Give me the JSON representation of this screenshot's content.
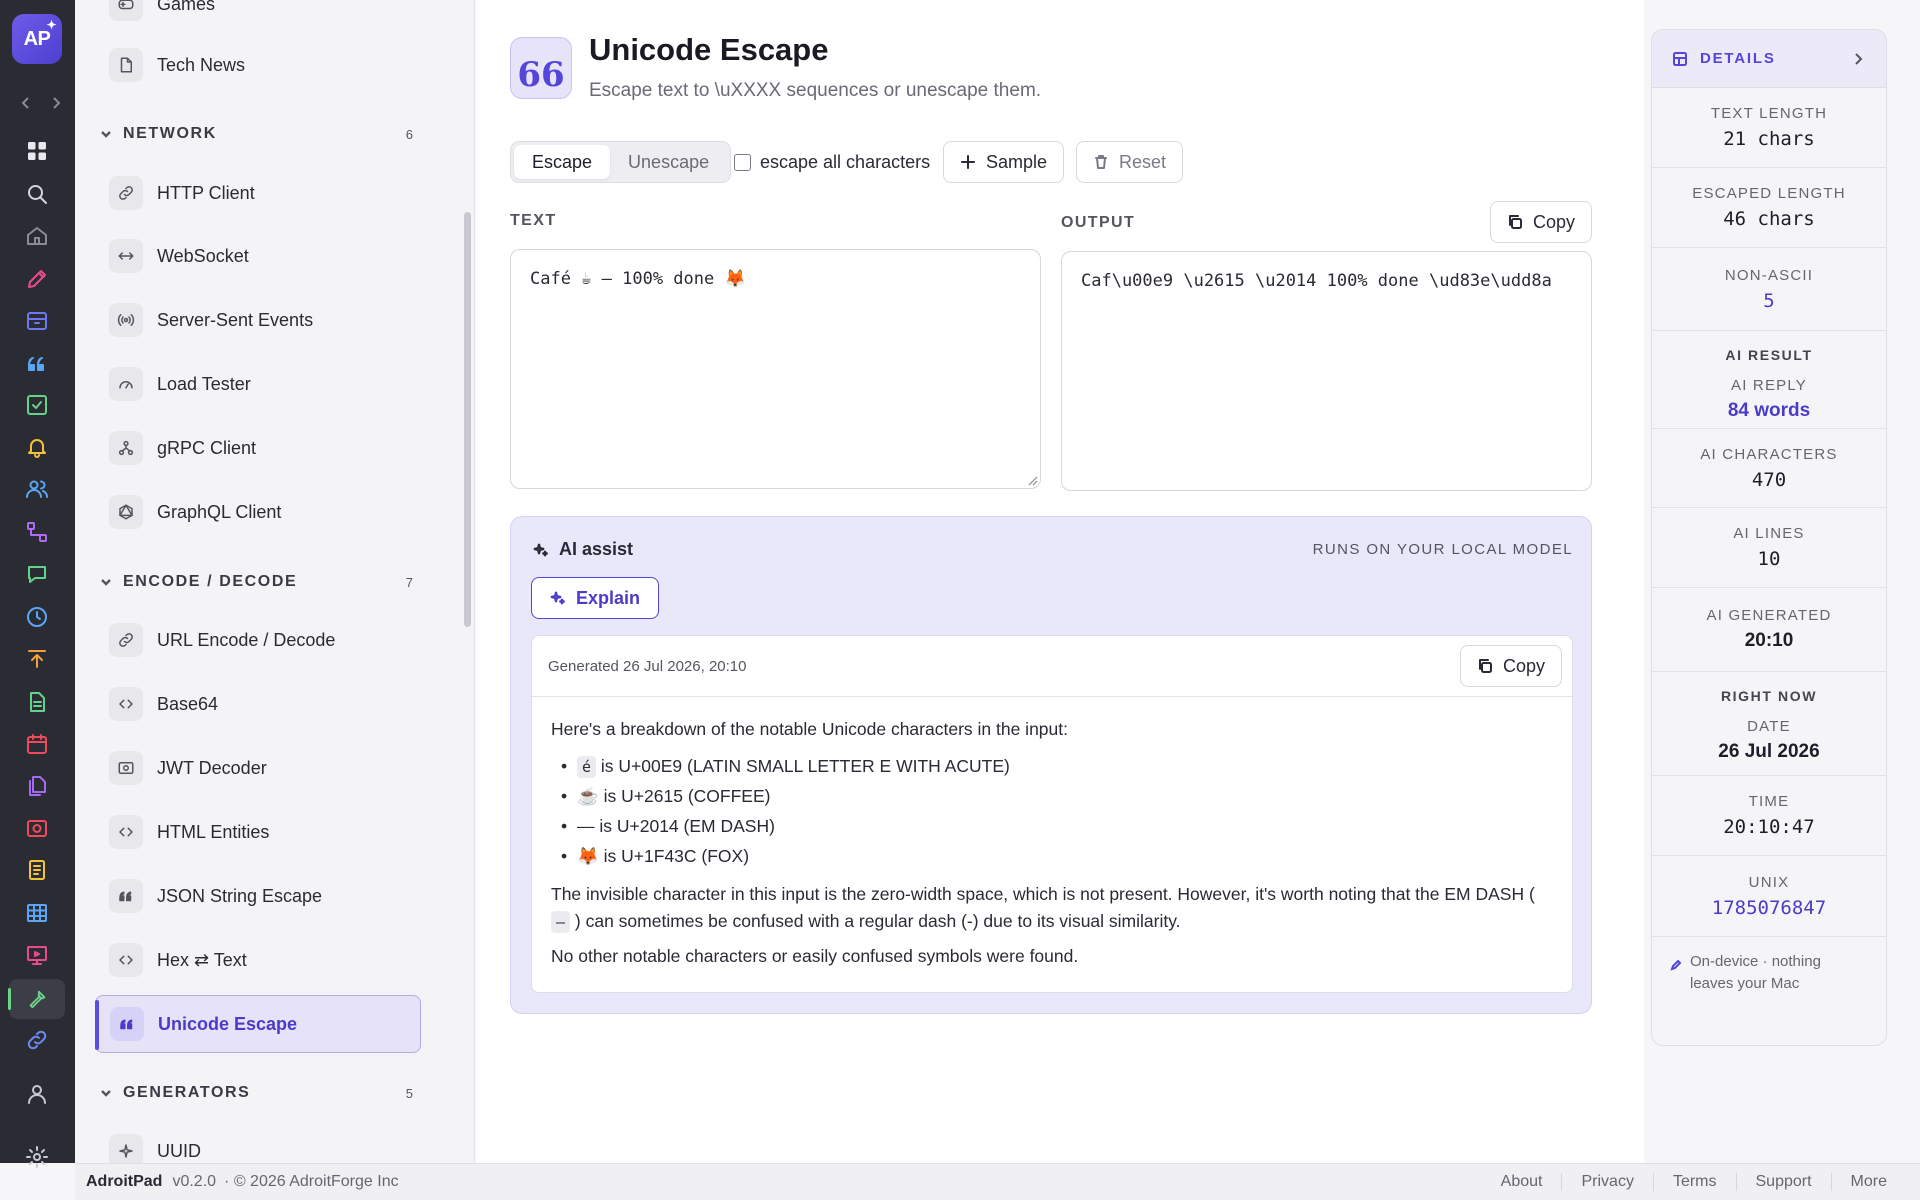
{
  "app": {
    "logo_text": "AP",
    "name": "AdroitPad",
    "version": "v0.2.0",
    "copyright": "· © 2026 AdroitForge Inc"
  },
  "sidebar": {
    "items_top": [
      {
        "label": "Games",
        "icon": "gamepad-icon"
      },
      {
        "label": "Tech News",
        "icon": "document-icon"
      }
    ],
    "sections": [
      {
        "name": "NETWORK",
        "count": "6",
        "items": [
          {
            "label": "HTTP Client",
            "icon": "link-icon"
          },
          {
            "label": "WebSocket",
            "icon": "arrows-horizontal-icon"
          },
          {
            "label": "Server-Sent Events",
            "icon": "broadcast-icon"
          },
          {
            "label": "Load Tester",
            "icon": "gauge-icon"
          },
          {
            "label": "gRPC Client",
            "icon": "nodes-icon"
          },
          {
            "label": "GraphQL Client",
            "icon": "graphql-icon"
          }
        ]
      },
      {
        "name": "ENCODE / DECODE",
        "count": "7",
        "items": [
          {
            "label": "URL Encode / Decode",
            "icon": "link-icon"
          },
          {
            "label": "Base64",
            "icon": "code-icon"
          },
          {
            "label": "JWT Decoder",
            "icon": "id-card-icon"
          },
          {
            "label": "HTML Entities",
            "icon": "code-icon"
          },
          {
            "label": "JSON String Escape",
            "icon": "quote-icon"
          },
          {
            "label": "Hex ⇄ Text",
            "icon": "code-icon"
          },
          {
            "label": "Unicode Escape",
            "icon": "quote-icon",
            "active": true
          }
        ]
      },
      {
        "name": "GENERATORS",
        "count": "5",
        "items": [
          {
            "label": "UUID",
            "icon": "sparkle-icon"
          }
        ]
      }
    ]
  },
  "header": {
    "icon_glyph": "66",
    "title": "Unicode Escape",
    "subtitle": "Escape text to \\uXXXX sequences or unescape them."
  },
  "toolbar": {
    "tabs": [
      "Escape",
      "Unescape"
    ],
    "active_tab": "Escape",
    "checkbox_label": "escape all characters",
    "checkbox_checked": false,
    "sample_label": "Sample",
    "reset_label": "Reset"
  },
  "input": {
    "label": "TEXT",
    "value": "Café ☕ — 100% done 🦊"
  },
  "output": {
    "label": "OUTPUT",
    "copy_label": "Copy",
    "value": "Caf\\u00e9 \\u2615 \\u2014 100% done \\ud83e\\udd8a"
  },
  "ai": {
    "title": "AI assist",
    "runs_on": "RUNS ON YOUR LOCAL MODEL",
    "explain_label": "Explain",
    "generated": "Generated 26 Jul 2026, 20:10",
    "copy_label": "Copy",
    "intro": "Here's a breakdown of the notable Unicode characters in the input:",
    "bullets": [
      {
        "char": "é",
        "text": "is U+00E9 (LATIN SMALL LETTER E WITH ACUTE)"
      },
      {
        "char": "☕",
        "text": "is U+2615 (COFFEE)"
      },
      {
        "char": "—",
        "text": "is U+2014 (EM DASH)"
      },
      {
        "char": "🦊",
        "text": "is U+1F43C (FOX)"
      }
    ],
    "para1a": "The invisible character in this input is the zero-width space, which is not present. However, it's worth noting that the EM DASH (",
    "para1_code": "—",
    "para1b": ") can sometimes be confused with a regular dash (-) due to its visual similarity.",
    "para2": "No other notable characters or easily confused symbols were found."
  },
  "details": {
    "title": "DETAILS",
    "rows1": [
      {
        "key": "TEXT LENGTH",
        "value": "21 chars"
      },
      {
        "key": "ESCAPED LENGTH",
        "value": "46 chars"
      },
      {
        "key": "NON-ASCII",
        "value": "5"
      }
    ],
    "ai_section": "AI RESULT",
    "rows2": [
      {
        "key": "AI REPLY",
        "value": "84 words"
      },
      {
        "key": "AI CHARACTERS",
        "value": "470"
      },
      {
        "key": "AI LINES",
        "value": "10"
      },
      {
        "key": "AI GENERATED",
        "value": "20:10"
      }
    ],
    "now_section": "RIGHT NOW",
    "rows3": [
      {
        "key": "DATE",
        "value": "26 Jul 2026"
      },
      {
        "key": "TIME",
        "value": "20:10:47"
      },
      {
        "key": "UNIX",
        "value": "1785076847"
      }
    ],
    "footer_note": "On-device · nothing leaves your Mac"
  },
  "footer_links": [
    "About",
    "Privacy",
    "Terms",
    "Support",
    "More"
  ],
  "colors": {
    "accent": "#5346d8",
    "rail": "#2b2b33",
    "ai_panel": "#e9e8fb"
  }
}
